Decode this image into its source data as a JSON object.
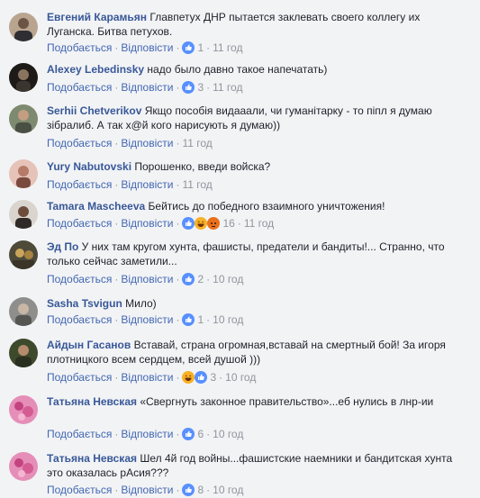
{
  "ui": {
    "like": "Подобається",
    "reply": "Відповісти",
    "dot": "·"
  },
  "comments": [
    {
      "author": "Евгений Карамьян",
      "text": "Главпетух ДНР пытается заклевать своего коллегу их Луганска. Битва петухов.",
      "reactions": [
        "like"
      ],
      "count": "1",
      "time": "11 год"
    },
    {
      "author": "Alexey Lebedinsky",
      "text": "надо было давно такое напечатать)",
      "reactions": [
        "like"
      ],
      "count": "3",
      "time": "11 год"
    },
    {
      "author": "Serhii Chetverikov",
      "text": "Якщо пособія видааали, чи гуманітарку - то піпл я думаю зібралиб. А так х@й кого нарисують я думаю))",
      "reactions": [],
      "count": "",
      "time": "11 год"
    },
    {
      "author": "Yury Nabutovski",
      "text": "Порошенко, введи войска?",
      "reactions": [],
      "count": "",
      "time": "11 год"
    },
    {
      "author": "Tamara Mascheeva",
      "text": "Бейтись до победного взаимного уничтожения!",
      "reactions": [
        "like",
        "haha",
        "angry"
      ],
      "count": "16",
      "time": "11 год"
    },
    {
      "author": "Эд По",
      "text": "У них там кругом хунта, фашисты, предатели и бандиты!... Странно, что только сейчас заметили...",
      "reactions": [
        "like"
      ],
      "count": "2",
      "time": "10 год"
    },
    {
      "author": "Sasha Tsvigun",
      "text": "Мило)",
      "reactions": [
        "like"
      ],
      "count": "1",
      "time": "10 год"
    },
    {
      "author": "Айдын Гасанов",
      "text": "Вставай, страна огромная,вставай на смертный бой! За игоря плотницкого всем сердцем, всей душой )))",
      "reactions": [
        "haha",
        "like"
      ],
      "count": "3",
      "time": "10 год"
    },
    {
      "author": "Татьяна Невская",
      "text": "«Свергнуть законное правительство»...еб    нулись в лнр-ии",
      "reactions": [
        "like"
      ],
      "count": "6",
      "time": "10 год"
    },
    {
      "author": "Татьяна Невская",
      "text": "Шел 4й год войны...фашистские наемники и бандитская хунта это оказалась рАсия???",
      "reactions": [
        "like"
      ],
      "count": "8",
      "time": "10 год"
    }
  ]
}
